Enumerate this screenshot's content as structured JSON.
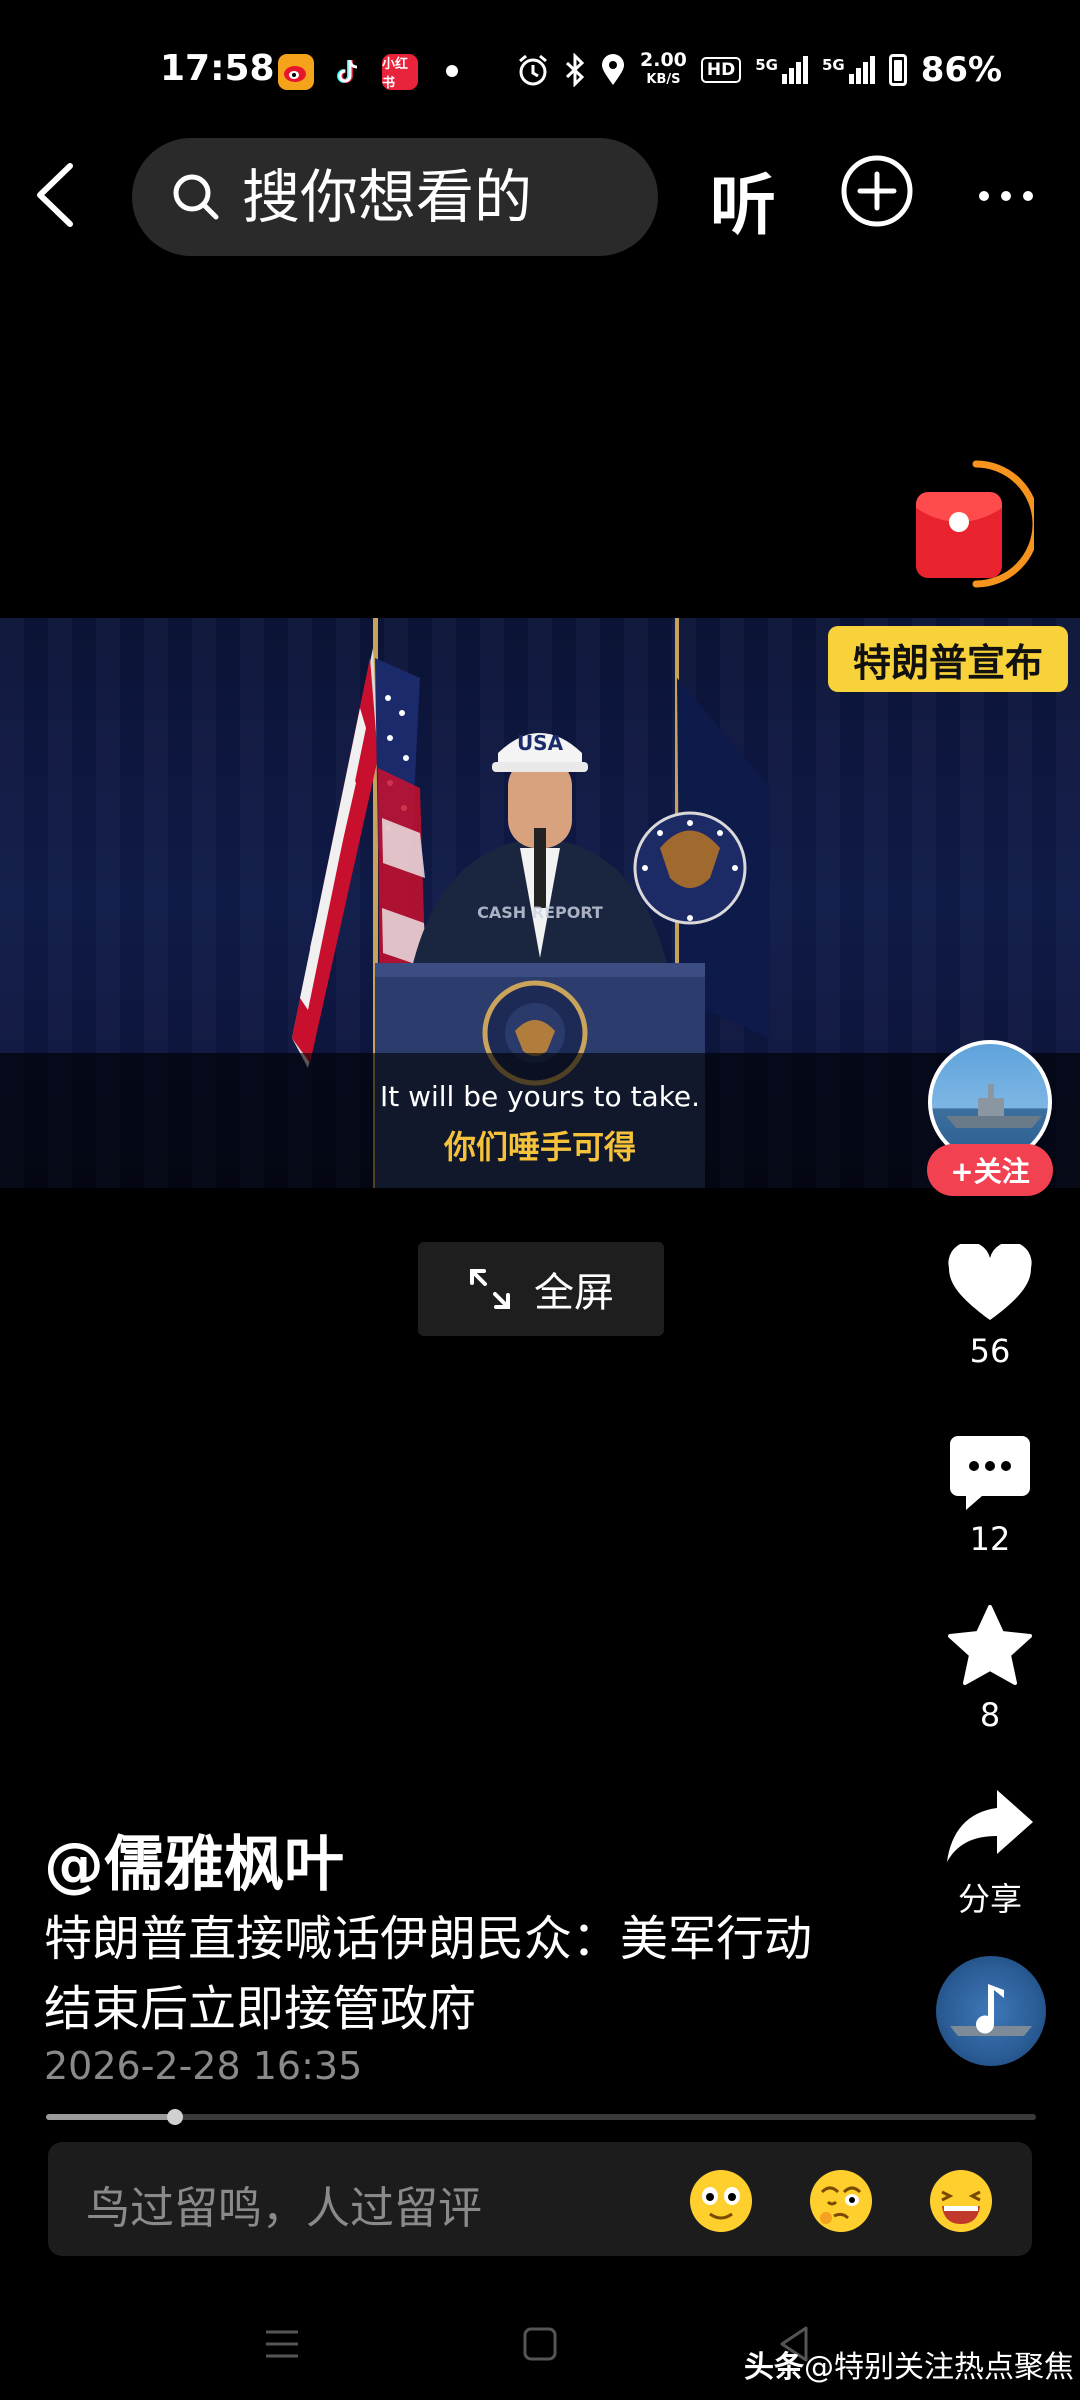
{
  "status_bar": {
    "time": "17:58",
    "app_icons": [
      {
        "name": "weibo-icon",
        "color": "#f6a31c"
      },
      {
        "name": "tiktok-icon",
        "color": "#000000"
      },
      {
        "name": "xiaohongshu-icon",
        "color": "#e8233b",
        "label": "小红书"
      }
    ],
    "net_speed_value": "2.00",
    "net_speed_unit": "KB/S",
    "hd_label": "HD",
    "signal_label": "5G",
    "battery": "86%"
  },
  "top_bar": {
    "search_placeholder": "搜你想看的",
    "listen_label": "听"
  },
  "video": {
    "subtitle_en": "It will be yours to take.",
    "subtitle_zh": "你们唾手可得",
    "cap_text": "USA",
    "watermark_text": "CASH REPORT"
  },
  "fullscreen_label": "全屏",
  "side_rail": {
    "announcement": "特朗普宣布",
    "follow_label": "+关注",
    "likes": "56",
    "comments": "12",
    "favorites": "8",
    "share_label": "分享"
  },
  "caption": {
    "author": "@儒雅枫叶",
    "description": "特朗普直接喊话伊朗民众：美军行动结束后立即接管政府",
    "date": "2026-2-28 16:35"
  },
  "progress": {
    "played_fraction": 0.13
  },
  "comment_input": {
    "placeholder": "鸟过留鸣，人过留评"
  },
  "watermark": {
    "brand": "头条",
    "handle": "@特别关注热点聚焦"
  },
  "colors": {
    "accent_red": "#f24150",
    "accent_yellow": "#f8d23a",
    "subtitle_yellow": "#f5c23a"
  }
}
